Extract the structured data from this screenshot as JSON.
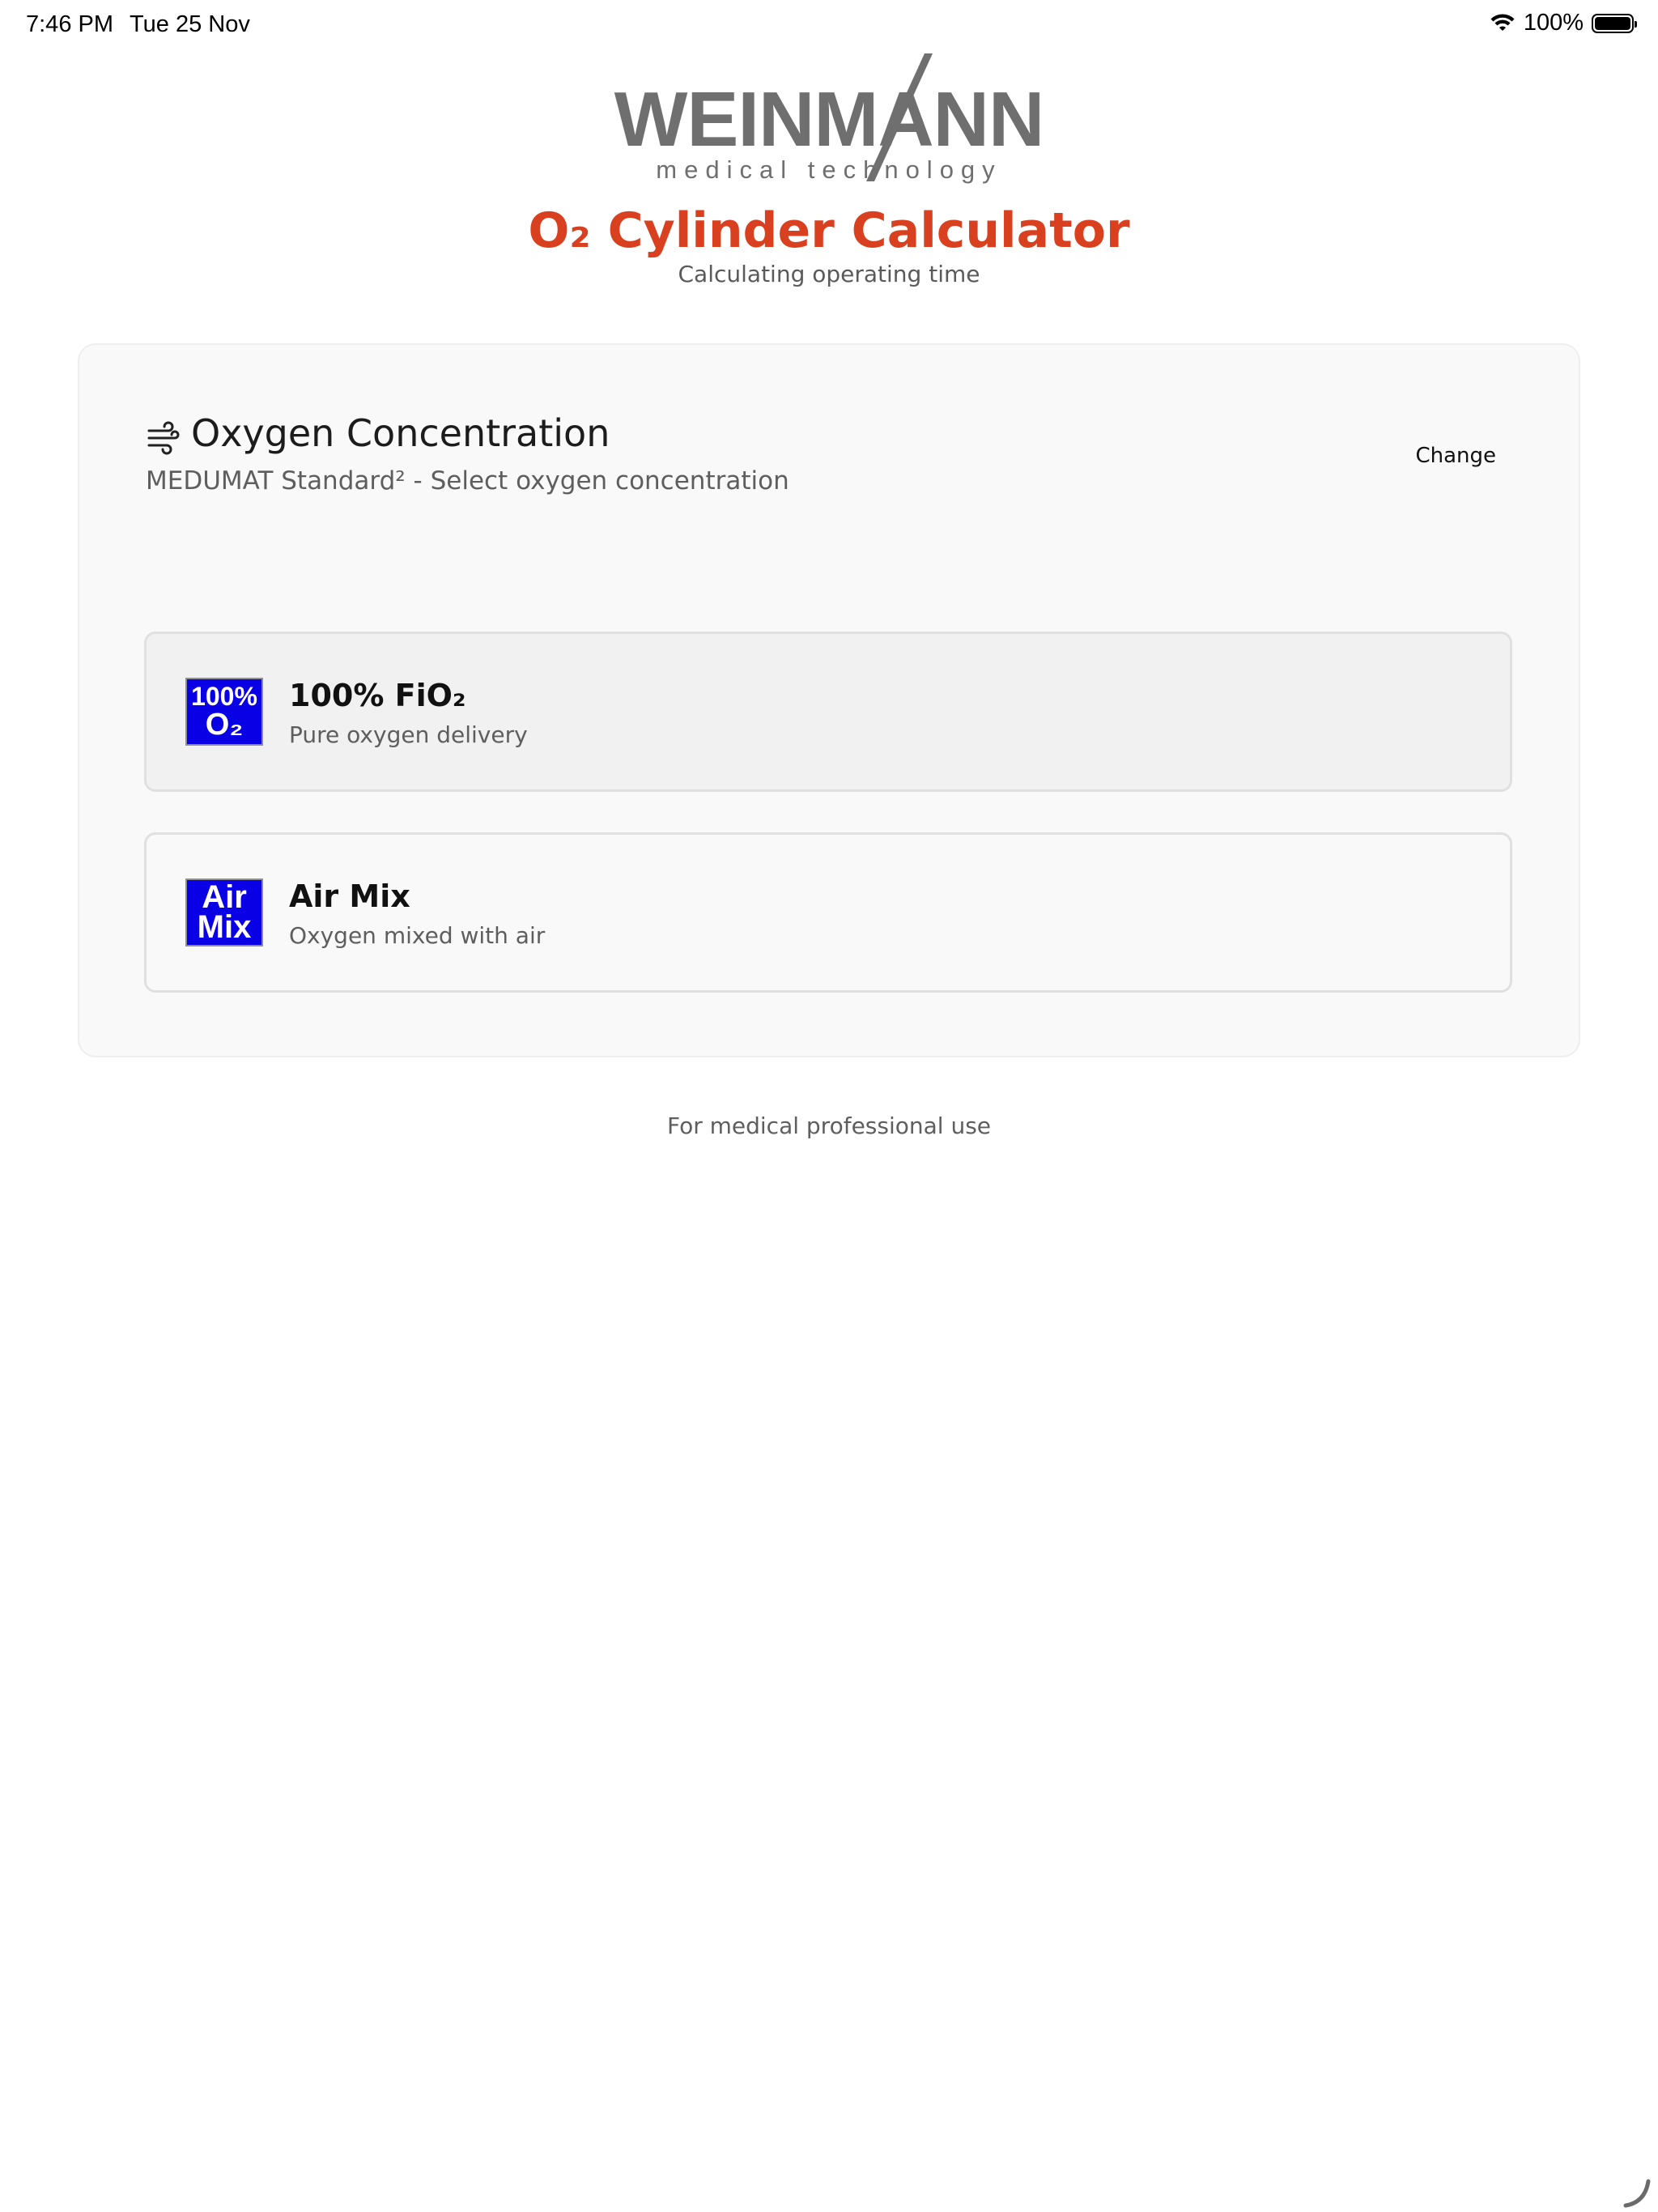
{
  "status_bar": {
    "time": "7:46 PM",
    "date": "Tue 25 Nov",
    "battery": "100%",
    "icons": [
      "wifi-icon",
      "battery-icon"
    ]
  },
  "logo": {
    "word": "WEINMANN",
    "tagline": "medical technology"
  },
  "header": {
    "title": "O₂ Cylinder Calculator",
    "subtitle": "Calculating operating time"
  },
  "section": {
    "icon": "wind-icon",
    "title": "Oxygen Concentration",
    "subtitle": "MEDUMAT Standard² - Select oxygen concentration",
    "change_label": "Change"
  },
  "options": [
    {
      "icon_line1": "100%",
      "icon_line2": "O₂",
      "title": "100% FiO₂",
      "description": "Pure oxygen delivery",
      "selected": true
    },
    {
      "icon_line1": "Air",
      "icon_line2": "Mix",
      "title": "Air Mix",
      "description": "Oxygen mixed with air",
      "selected": false
    }
  ],
  "footer": {
    "text": "For medical professional use"
  },
  "colors": {
    "accent": "#d9401f",
    "icon_blue": "#0a00e6",
    "logo_gray": "#6f6f6f"
  }
}
